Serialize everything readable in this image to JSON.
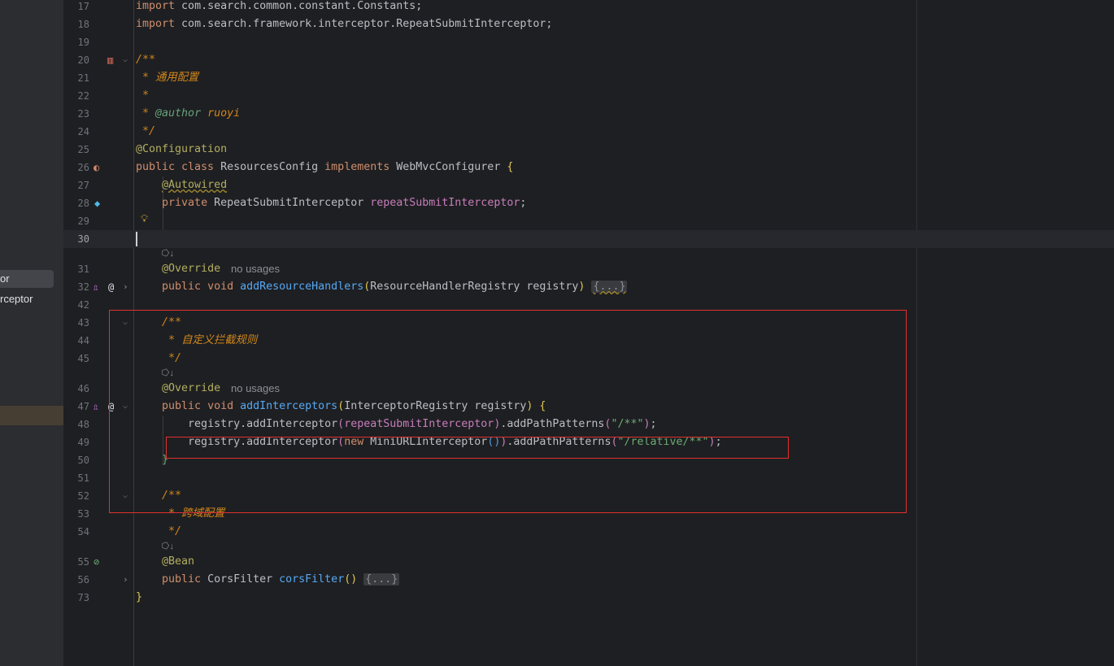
{
  "side_panel": {
    "items": [
      {
        "label": "or",
        "selected": true
      },
      {
        "label": "rceptor",
        "selected": false
      }
    ]
  },
  "editor": {
    "line_numbers": [
      "17",
      "18",
      "19",
      "20",
      "21",
      "22",
      "23",
      "24",
      "25",
      "26",
      "27",
      "28",
      "29",
      "30",
      "31",
      "32",
      "42",
      "43",
      "44",
      "45",
      "46",
      "47",
      "48",
      "49",
      "50",
      "51",
      "52",
      "53",
      "54",
      "55",
      "56",
      "73"
    ],
    "lines": {
      "l17": {
        "kw": "import",
        "rest": " com.search.common.constant.Constants;"
      },
      "l18": {
        "kw": "import",
        "rest": " com.search.framework.interceptor.RepeatSubmitInterceptor;"
      },
      "l20": {
        "text": "/**"
      },
      "l21": {
        "star": " * ",
        "text": "通用配置"
      },
      "l22": {
        "text": " *"
      },
      "l23": {
        "star": " * ",
        "tag": "@author",
        "value": " ruoyi"
      },
      "l24": {
        "text": " */"
      },
      "l25": {
        "ann": "@Configuration"
      },
      "l26": {
        "kw1": "public class ",
        "name": "ResourcesConfig ",
        "kw2": "implements ",
        "iface": "WebMvcConfigurer ",
        "brace": "{"
      },
      "l27": {
        "ann": "@Autowired"
      },
      "l28": {
        "kw": "private ",
        "type": "RepeatSubmitInterceptor ",
        "field": "repeatSubmitInterceptor",
        "end": ";"
      },
      "l31": {
        "ann": "@Override",
        "usages": "no usages"
      },
      "l32": {
        "kw": "public void ",
        "method": "addResourceHandlers",
        "po": "(",
        "params": "ResourceHandlerRegistry registry",
        "pc": ")",
        "folded": "{...}"
      },
      "l43": {
        "text": "/**"
      },
      "l44": {
        "star": " * ",
        "text": "自定义拦截规则"
      },
      "l45": {
        "text": " */"
      },
      "l46": {
        "ann": "@Override",
        "usages": "no usages"
      },
      "l47": {
        "kw": "public void ",
        "method": "addInterceptors",
        "po": "(",
        "params": "InterceptorRegistry registry",
        "pc": ")",
        "brace": " {"
      },
      "l48": {
        "call": "registry.addInterceptor",
        "po": "(",
        "field": "repeatSubmitInterceptor",
        "pc": ")",
        "call2": ".addPathPatterns",
        "po2": "(",
        "str": "\"/**\"",
        "pc2": ")",
        "end": ";"
      },
      "l49": {
        "call": "registry.addInterceptor",
        "po": "(",
        "kw": "new ",
        "cls": "MiniURLInterceptor",
        "inner": "()",
        "pc": ")",
        "call2": ".addPathPatterns",
        "po2": "(",
        "str": "\"/relative/**\"",
        "pc2": ")",
        "end": ";"
      },
      "l50": {
        "brace": "}"
      },
      "l52": {
        "text": "/**"
      },
      "l53": {
        "star": " * ",
        "text": "跨域配置"
      },
      "l54": {
        "text": " */"
      },
      "l55": {
        "ann": "@Bean"
      },
      "l56": {
        "kw": "public ",
        "type": "CorsFilter ",
        "method": "corsFilter",
        "parens": "()",
        "folded": "{...}"
      },
      "l73": {
        "brace": "}"
      }
    }
  },
  "gutter_icons": [
    "bookmark-icon",
    "bean-icon",
    "autowired-bean-icon",
    "intention-bulb-icon",
    "override-icon",
    "at-icon",
    "bean-method-icon",
    "fold-arrow-icon",
    "run-icon"
  ],
  "colors": {
    "background": "#1e1f22",
    "highlight_box": "#e0312f",
    "keyword": "#cf8e6d",
    "annotation": "#b3ae60",
    "method": "#56a8f5",
    "string": "#6aab73",
    "field": "#c77dbb",
    "comment": "#d0861b"
  }
}
